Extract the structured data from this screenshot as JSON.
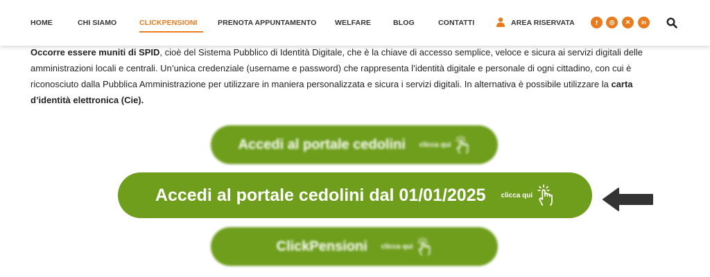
{
  "nav": {
    "items": [
      "HOME",
      "CHI SIAMO",
      "CLICKPENSIONI",
      "PRENOTA APPUNTAMENTO",
      "WELFARE",
      "BLOG",
      "CONTATTI"
    ],
    "active": "CLICKPENSIONI",
    "area_riservata": "AREA RISERVATA",
    "social": [
      {
        "icon": "facebook-icon",
        "glyph": "f"
      },
      {
        "icon": "instagram-icon",
        "glyph": "◎"
      },
      {
        "icon": "x-icon",
        "glyph": "✕"
      },
      {
        "icon": "linkedin-icon",
        "glyph": "in"
      }
    ],
    "accent_color": "#e87b1e"
  },
  "content": {
    "strong1": "Occorre essere muniti di SPID",
    "text1": ", cioè del Sistema Pubblico di Identità Digitale, che è la chiave di accesso semplice, veloce e sicura ai servizi digitali delle amministrazioni locali e centrali. Un’unica credenziale (username e password) che rappresenta l’identità digitale e personale di ogni cittadino, con cui è riconosciuto dalla Pubblica Amministrazione per utilizzare in maniera personalizzata e sicura i servizi digitali. In alternativa è possibile utilizzare la ",
    "strong2": "carta d’identità elettronica (Cie)."
  },
  "buttons": [
    {
      "label": "Accedi al portale cedolini",
      "sub": "clicca qui"
    },
    {
      "label": "Accedi al portale cedolini dal 01/01/2025",
      "sub": "clicca qui"
    },
    {
      "label": "ClickPensioni",
      "sub": "clicca qui"
    }
  ],
  "colors": {
    "button_green": "#6e9e1c",
    "arrow": "#333333"
  }
}
